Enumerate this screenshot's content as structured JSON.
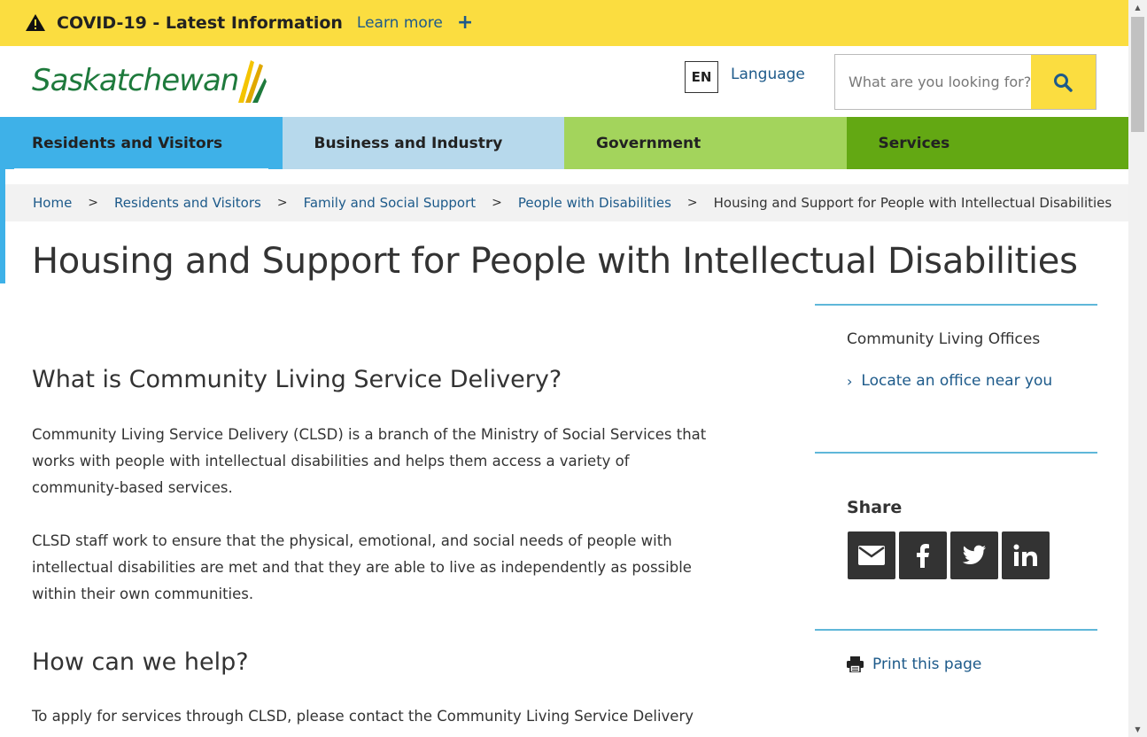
{
  "covid_banner": {
    "title": "COVID-19 - Latest Information",
    "learn_more": "Learn more",
    "expand": "+",
    "icon": "warning-icon",
    "background": "#fbdd40"
  },
  "header": {
    "logo_text": "Saskatchewan",
    "language_code": "EN",
    "language_label": "Language",
    "search_placeholder": "What are you looking for?",
    "search_icon": "search-icon"
  },
  "nav": {
    "items": [
      {
        "label": "Residents and Visitors",
        "color": "#3eb1e8"
      },
      {
        "label": "Business and Industry",
        "color": "#b7d9ec"
      },
      {
        "label": "Government",
        "color": "#a3d45c"
      },
      {
        "label": "Services",
        "color": "#63a813"
      }
    ]
  },
  "breadcrumb": {
    "items": [
      "Home",
      "Residents and Visitors",
      "Family and Social Support",
      "People with Disabilities"
    ],
    "separator": ">",
    "current": "Housing and Support for People with Intellectual Disabilities"
  },
  "page_title": "Housing and Support for People with Intellectual Disabilities",
  "main": {
    "section1_heading": "What is Community Living Service Delivery?",
    "section1_p1_lines": [
      "Community Living Service Delivery (CLSD) is a branch of the Ministry of Social Services that",
      "works with people with intellectual disabilities and helps them access a variety of",
      "community-based services."
    ],
    "section1_p2_lines": [
      "CLSD staff work to ensure that the physical, emotional, and social needs of people with",
      "intellectual disabilities are met and that they are able to live as independently as possible",
      "within their own communities."
    ],
    "section2_heading": "How can we help?",
    "section2_p1_lines": [
      "To apply for services through CLSD, please contact the Community Living Service Delivery"
    ]
  },
  "sidebar": {
    "offices_title": "Community Living Offices",
    "offices_link": "Locate an office near you",
    "share_title": "Share",
    "share_icons": [
      "email-icon",
      "facebook-icon",
      "twitter-icon",
      "linkedin-icon"
    ],
    "print_label": "Print this page",
    "rule_color": "#5fb7d9"
  }
}
